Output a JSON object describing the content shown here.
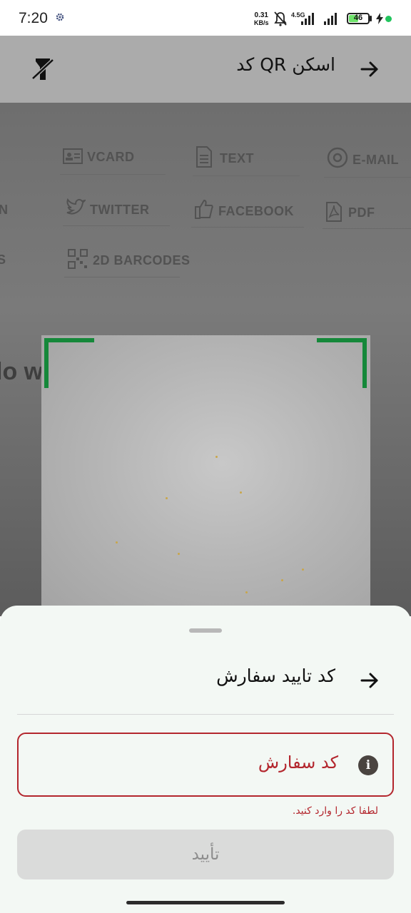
{
  "status_bar": {
    "time": "7:20",
    "net_speed_value": "0.31",
    "net_speed_unit": "KB/s",
    "network_type": "4.5G",
    "battery_level": "46",
    "battery_fraction": 0.46,
    "icons": [
      "settings-gear-icon",
      "bell-muted-icon",
      "signal-icon",
      "battery-icon",
      "charging-icon"
    ]
  },
  "app_bar": {
    "title": "اسکن QR کد",
    "back_icon": "arrow-right-icon",
    "flash_icon": "flash-off-icon"
  },
  "camera": {
    "paper_labels": [
      "VCARD",
      "TEXT",
      "E-MAIL",
      "N",
      "TWITTER",
      "FACEBOOK",
      "PDF",
      "S",
      "2D BARCODES"
    ],
    "typed_text": "lo world"
  },
  "sheet": {
    "title": "کد تایید سفارش",
    "field_label": "کد سفارش",
    "error_text": "لطفا کد را وارد کنید.",
    "confirm_label": "تأیید"
  },
  "colors": {
    "accent_error": "#b3262d",
    "scanner_corner": "#15883a",
    "app_bar": "#ababab",
    "sheet_bg": "#f3f8f4"
  }
}
